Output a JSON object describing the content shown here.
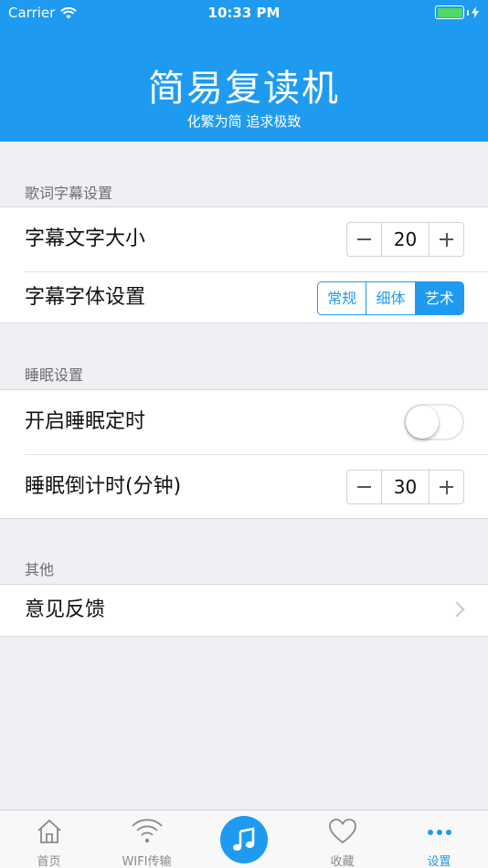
{
  "status_bar": {
    "carrier": "Carrier",
    "time": "10:33 PM"
  },
  "header": {
    "title": "简易复读机",
    "subtitle": "化繁为简 追求极致"
  },
  "sections": {
    "lyrics": {
      "title": "歌词字幕设置",
      "font_size_label": "字幕文字大小",
      "font_size_value": "20",
      "font_style_label": "字幕字体设置",
      "font_styles": [
        "常规",
        "细体",
        "艺术"
      ],
      "selected_font_style": "艺术"
    },
    "sleep": {
      "title": "睡眠设置",
      "timer_label": "开启睡眠定时",
      "timer_enabled": false,
      "countdown_label": "睡眠倒计时(分钟)",
      "countdown_value": "30"
    },
    "other": {
      "title": "其他",
      "feedback_label": "意见反馈"
    }
  },
  "tabbar": {
    "items": [
      {
        "label": "首页",
        "icon": "home-icon"
      },
      {
        "label": "WIFI传输",
        "icon": "wifi-icon"
      },
      {
        "label": "",
        "icon": "music-note-icon"
      },
      {
        "label": "收藏",
        "icon": "heart-icon"
      },
      {
        "label": "设置",
        "icon": "more-dots-icon"
      }
    ],
    "active_index": 4
  },
  "colors": {
    "accent": "#1e9bf0",
    "background": "#efeff4",
    "battery": "#4cd964"
  }
}
